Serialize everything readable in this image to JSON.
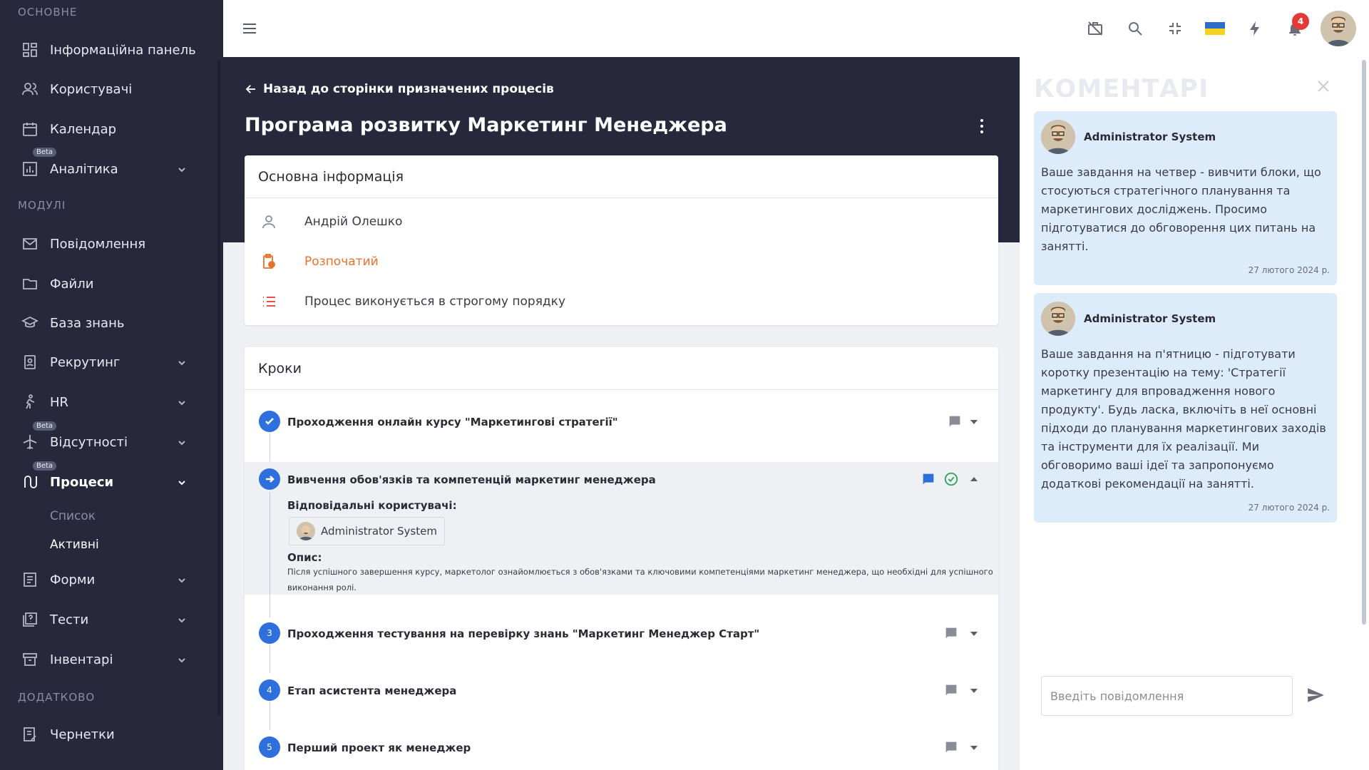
{
  "sidebar": {
    "sections": {
      "main": "ОСНОВНЕ",
      "modules": "МОДУЛІ",
      "extra": "ДОДАТКОВО"
    },
    "items": {
      "dashboard": "Інформаційна панель",
      "users": "Користувачі",
      "calendar": "Календар",
      "analytics": "Аналітика",
      "messages": "Повідомлення",
      "files": "Файли",
      "knowledge": "База знань",
      "recruiting": "Рекрутинг",
      "hr": "HR",
      "absences": "Відсутності",
      "processes": "Процеси",
      "forms": "Форми",
      "tests": "Тести",
      "inventory": "Інвентарі",
      "drafts": "Чернетки"
    },
    "processes_sub": {
      "list": "Список",
      "active": "Активні"
    },
    "beta_label": "Beta"
  },
  "topbar": {
    "notification_count": "4",
    "language_flag": "ua-flag"
  },
  "main": {
    "back_link": "Назад до сторінки призначених процесів",
    "title": "Програма розвитку Маркетинг Менеджера",
    "info_card": {
      "heading": "Основна інформація",
      "assignee": "Андрій Олешко",
      "status": "Розпочатий",
      "order": "Процес виконується в строгому порядку"
    },
    "steps_card": {
      "heading": "Кроки",
      "steps": [
        {
          "num": "",
          "title": "Проходження онлайн курсу \"Маркетингові стратегії\""
        },
        {
          "num": "",
          "title": "Вивчення обов'язків та компетенцій маркетинг менеджера"
        },
        {
          "num": "3",
          "title": "Проходження тестування на перевірку знань \"Маркетинг Менеджер Старт\""
        },
        {
          "num": "4",
          "title": "Етап асистента менеджера"
        },
        {
          "num": "5",
          "title": "Перший проект як менеджер"
        }
      ],
      "expanded": {
        "responsible_label": "Відповідальні користувачі:",
        "responsible_user": "Administrator System",
        "description_label": "Опис:",
        "description_line1": "Після успішного завершення курсу, маркетолог ознайомлюється з обов'язками та ключовими компетенціями маркетинг менеджера, що необхідні для успішного",
        "description_line2": "виконання ролі."
      }
    }
  },
  "comments": {
    "title": "КОМЕНТАРІ",
    "items": [
      {
        "author": "Administrator System",
        "text": "Ваше завдання на четвер - вивчити блоки, що стосуються стратегічного планування та маркетингових досліджень. Просимо підготуватися до обговорення цих питань на занятті.",
        "date": "27 лютого 2024 р."
      },
      {
        "author": "Administrator System",
        "text": "Ваше завдання на п'ятницю - підготувати коротку презентацію на тему: 'Стратегії маркетингу для впровадження нового продукту'. Будь ласка, включіть в неї основні підходи до планування маркетингових заходів та інструменти для їх реалізації. Ми обговоримо ваші ідеї та запропонуємо додаткові рекомендації на занятті.",
        "date": "27 лютого 2024 р."
      }
    ],
    "input_placeholder": "Введіть повідомлення"
  },
  "colors": {
    "sidebar": "#27283c",
    "accent": "#2e6fde",
    "status_orange": "#e8712b",
    "comment_bg": "#dcecfb"
  }
}
